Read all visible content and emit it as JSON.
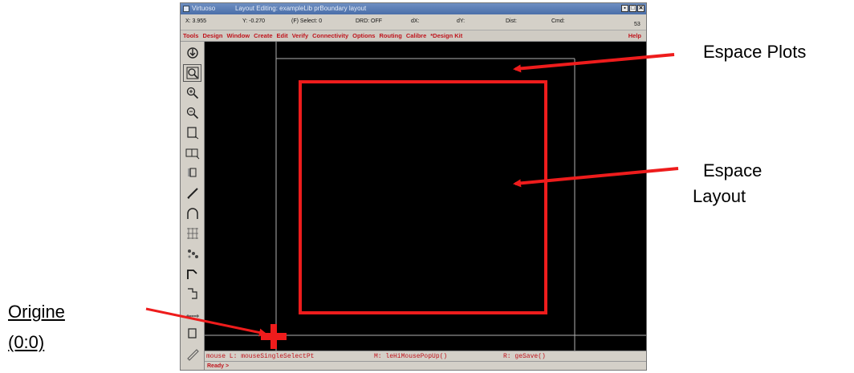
{
  "window": {
    "app_title": "Virtuoso",
    "doc_title": "Layout Editing: exampleLib prBoundary layout",
    "title_buttons": [
      "▪",
      "□",
      "✕"
    ]
  },
  "coords": {
    "x": "X: 3.955",
    "y": "Y: -0.270",
    "select": "(F) Select: 0",
    "drd": "DRD: OFF",
    "dx": "dX:",
    "dy": "dY:",
    "dist": "Dist:",
    "cmd": "Cmd:",
    "num": "53"
  },
  "menu": {
    "items": [
      "Tools",
      "Design",
      "Window",
      "Create",
      "Edit",
      "Verify",
      "Connectivity",
      "Options",
      "Routing",
      "Calibre",
      "*Design Kit"
    ],
    "help": "Help"
  },
  "toolbar": {
    "icons": [
      "save-icon",
      "zoom-fit-icon",
      "zoom-in-icon",
      "zoom-out-icon",
      "rectangle-icon",
      "instance-icon",
      "pin-icon",
      "path-icon",
      "arc-icon",
      "grid-icon",
      "cells-icon",
      "step-icon",
      "polygon-icon",
      "ruler-icon",
      "select-icon",
      "pencil-icon"
    ]
  },
  "status": {
    "mouse_l": "mouse L: mouseSingleSelectPt",
    "mouse_m": "M: leHiMousePopUp()",
    "mouse_r": "R: geSave()",
    "ready": "Ready >"
  },
  "annotations": {
    "plots": "Espace Plots",
    "layout_line1": "Espace",
    "layout_line2": "Layout",
    "origin_line1": "Origine",
    "origin_line2": "(0:0)"
  },
  "colors": {
    "annotation_red": "#ee1c1c",
    "boundary_grey": "#b0b0b0",
    "canvas_bg": "#000000",
    "menu_text": "#c0141c"
  }
}
